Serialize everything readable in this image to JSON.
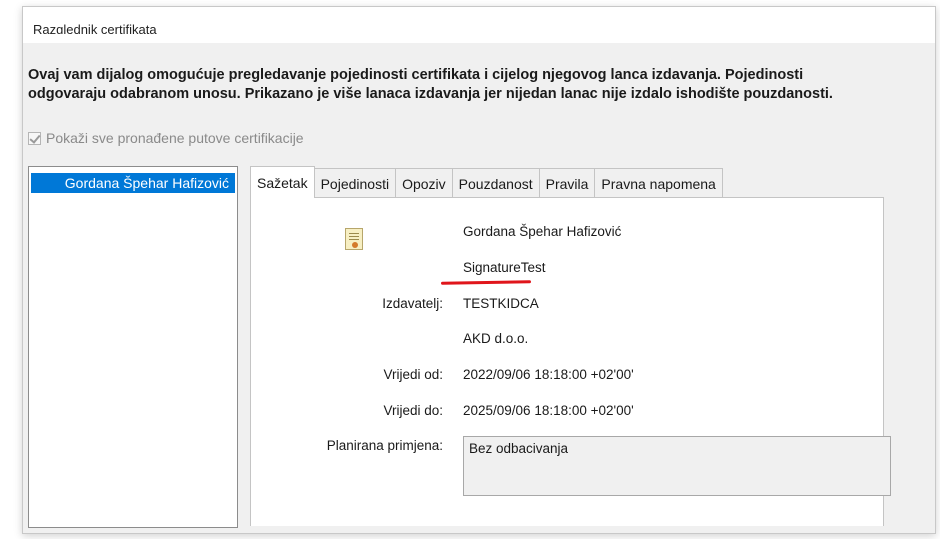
{
  "dialog": {
    "title": "Razglednik certifikata",
    "intro_line1": "Ovaj vam dijalog omogućuje pregledavanje pojedinosti certifikata i cijelog njegovog lanca izdavanja. Pojedinosti",
    "intro_line2": "odgovaraju odabranom unosu. Prikazano je više lanaca izdavanja jer nijedan lanac nije izdalo ishodište pouzdanosti.",
    "show_all_paths": {
      "label": "Pokaži sve pronađene putove certifikacije",
      "checked": true,
      "enabled": false
    }
  },
  "tree": {
    "items": [
      {
        "label": "Gordana Špehar Hafizović",
        "selected": true
      }
    ]
  },
  "tabs": [
    {
      "label": "Sažetak",
      "active": true
    },
    {
      "label": "Pojedinosti",
      "active": false
    },
    {
      "label": "Opoziv",
      "active": false
    },
    {
      "label": "Pouzdanost",
      "active": false
    },
    {
      "label": "Pravila",
      "active": false
    },
    {
      "label": "Pravna napomena",
      "active": false
    }
  ],
  "summary": {
    "icon": "certificate-icon",
    "subject_name": "Gordana Špehar Hafizović",
    "subject_org": "SignatureTest",
    "issuer_label": "Izdavatelj:",
    "issuer_name": "TESTKIDCA",
    "issuer_org": "AKD d.o.o.",
    "valid_from_label": "Vrijedi od:",
    "valid_from": "2022/09/06 18:18:00 +02'00'",
    "valid_to_label": "Vrijedi do:",
    "valid_to": "2025/09/06 18:18:00 +02'00'",
    "intended_usage_label": "Planirana primjena:",
    "intended_usage": "Bez odbacivanja"
  },
  "annotation": {
    "underline_color": "#e0151b"
  },
  "colors": {
    "selection": "#0078d7",
    "background": "#f0f0f0"
  }
}
